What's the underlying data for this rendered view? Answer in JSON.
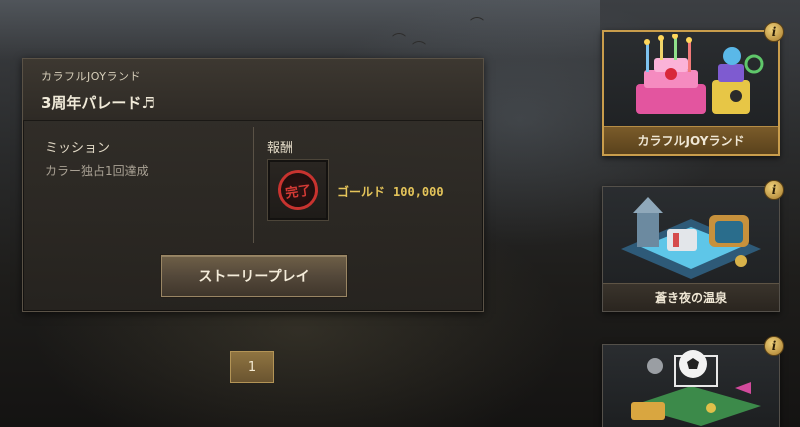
{
  "mission_panel": {
    "event_name": "カラフルJOYランド",
    "event_title": "3周年パレード♬",
    "mission_heading": "ミッション",
    "mission_description": "カラー独占1回達成",
    "reward_heading": "報酬",
    "reward_stamp": "完了",
    "reward_item": "ゴールド",
    "reward_amount": "100,000",
    "story_button_label": "ストーリープレイ"
  },
  "pagination": {
    "current_page": "1"
  },
  "event_cards": [
    {
      "label": "カラフルJOYランド",
      "icon": "birthday-cake-icon",
      "active": true
    },
    {
      "label": "蒼き夜の温泉",
      "icon": "hot-spring-icon",
      "active": false
    },
    {
      "label": "",
      "icon": "soccer-ball-icon",
      "active": false
    }
  ],
  "info_icon_glyph": "i",
  "colors": {
    "accent_gold": "#c99d4c",
    "reward_text": "#e4c45a",
    "stamp_red": "#c8332f",
    "panel_bg": "#34302a"
  }
}
